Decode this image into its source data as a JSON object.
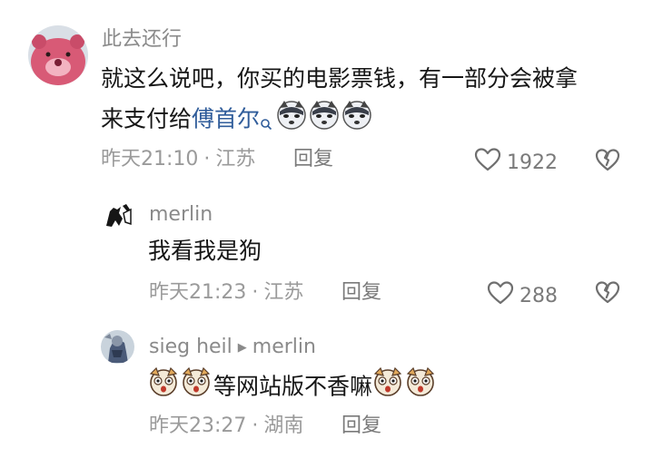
{
  "comments": [
    {
      "username": "此去还行",
      "text_line1": "就这么说吧，你买的电影票钱，有一部分会被拿",
      "text_line2_prefix": "来支付给",
      "text_link": "傅首尔",
      "emoji_icon": "husky-emoji-icon",
      "time": "昨天21:10",
      "location": "江苏",
      "reply_label": "回复",
      "like_count": "1922"
    }
  ],
  "replies": [
    {
      "username": "merlin",
      "text": "我看我是狗",
      "time": "昨天21:23",
      "location": "江苏",
      "reply_label": "回复",
      "like_count": "288"
    },
    {
      "username": "sieg heil",
      "reply_to": "merlin",
      "text": "等网站版不香嘛",
      "emoji_icon": "dog-face-emoji-icon",
      "time": "昨天23:27",
      "location": "湖南",
      "reply_label": "回复"
    }
  ],
  "meta_separator": "·",
  "colors": {
    "text": "#161616",
    "meta": "#9a9a9a",
    "link": "#2f5c9a"
  }
}
